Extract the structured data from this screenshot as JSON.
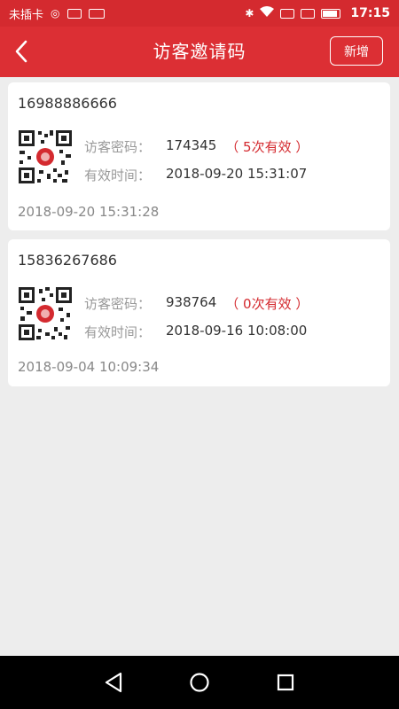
{
  "status_bar": {
    "carrier": "未插卡",
    "time": "17:15",
    "icons": [
      "sim-missing-icon",
      "image-icon",
      "keyboard-icon",
      "bluetooth-icon",
      "wifi-icon",
      "sim1-icon",
      "sim2-icon",
      "battery-icon"
    ]
  },
  "header": {
    "back_icon": "chevron-left-icon",
    "title": "访客邀请码",
    "add_label": "新增"
  },
  "invites": [
    {
      "phone": "16988886666",
      "password_label": "访客密码：",
      "password": "174345",
      "times": "（ 5次有效 ）",
      "valid_label": "有效时间：",
      "valid_until": "2018-09-20 15:31:07",
      "created": "2018-09-20 15:31:28"
    },
    {
      "phone": "15836267686",
      "password_label": "访客密码：",
      "password": "938764",
      "times": "（ 0次有效 ）",
      "valid_label": "有效时间：",
      "valid_until": "2018-09-16 10:08:00",
      "created": "2018-09-04 10:09:34"
    }
  ],
  "nav": {
    "icons": [
      "back-triangle-icon",
      "home-circle-icon",
      "recents-square-icon"
    ]
  },
  "colors": {
    "accent": "#dc2f34",
    "highlight": "#d42a2f",
    "background": "#ededed"
  }
}
